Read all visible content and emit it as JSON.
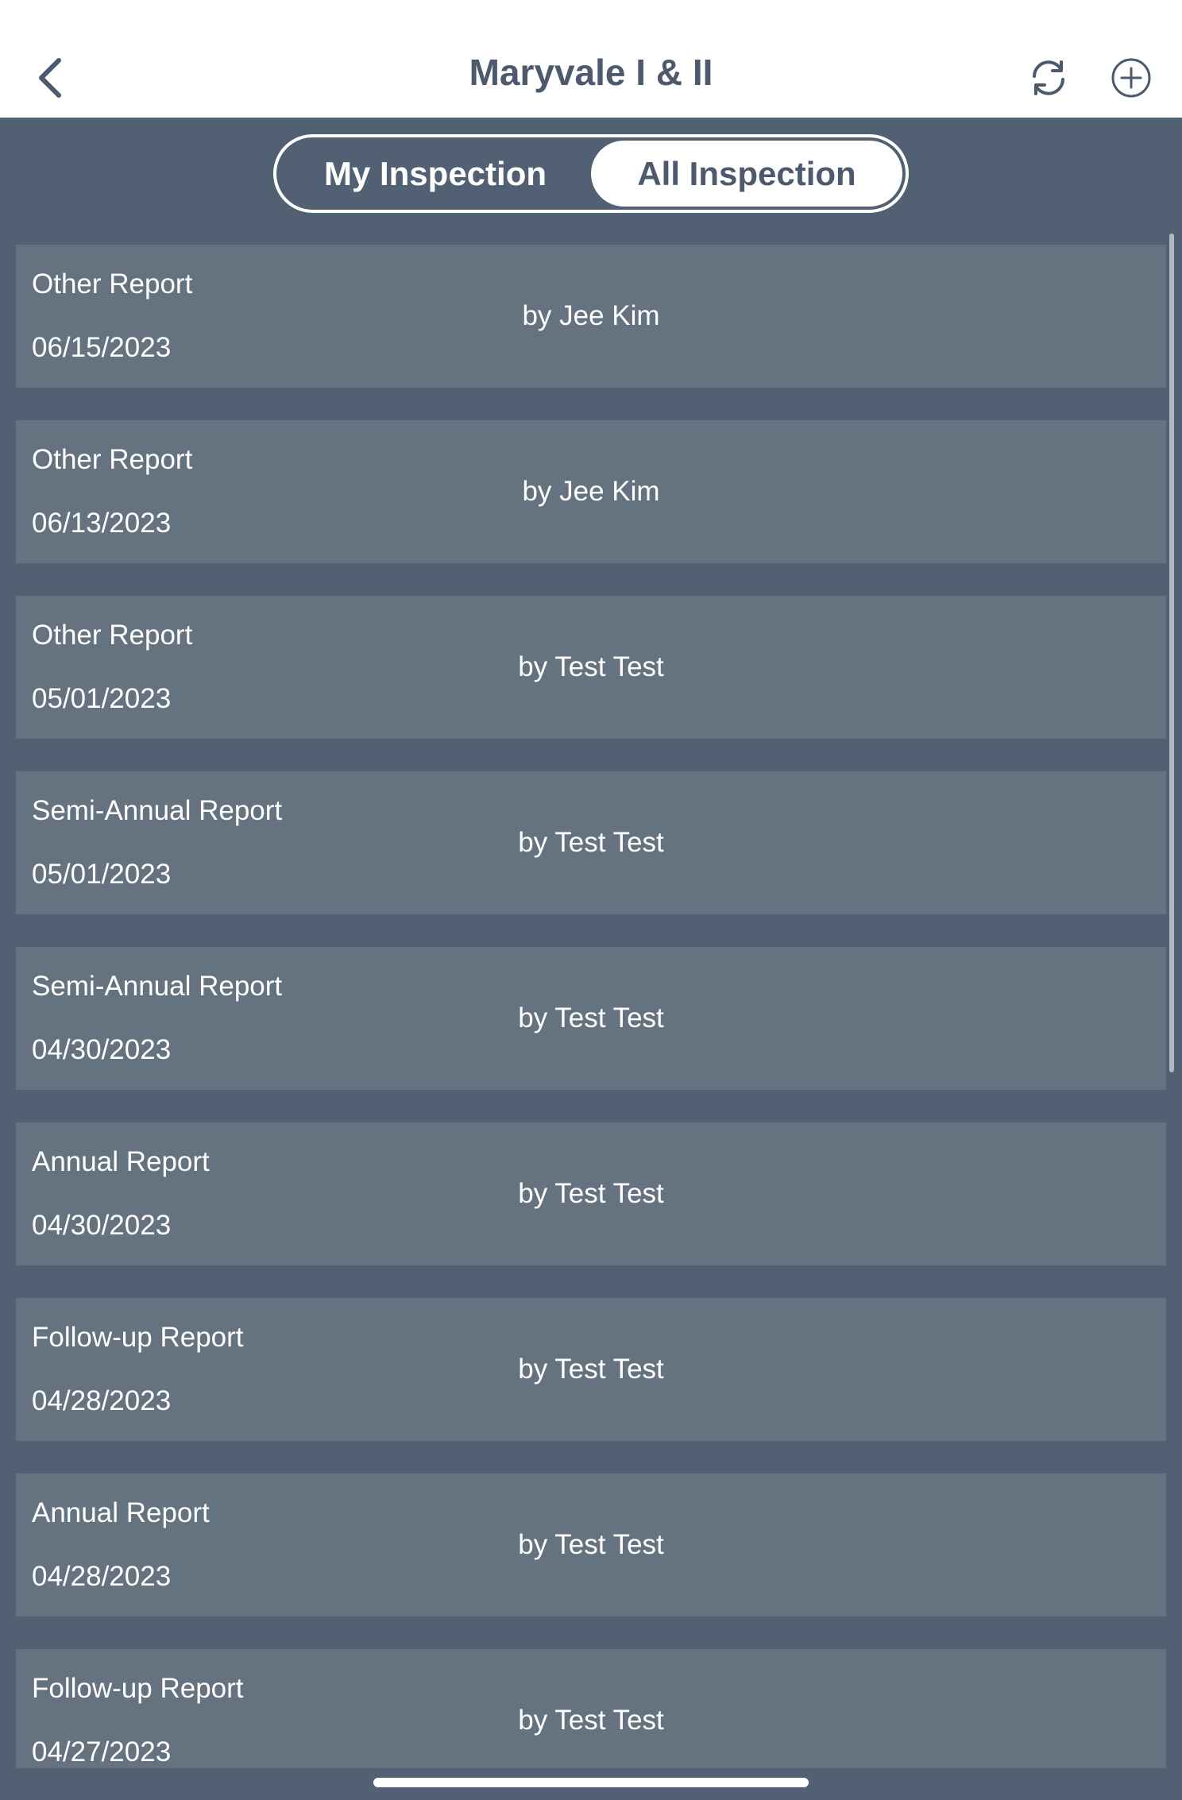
{
  "header": {
    "title": "Maryvale I & II",
    "back_icon": "chevron-left-icon",
    "sync_icon": "refresh-icon",
    "add_icon": "plus-circle-icon"
  },
  "segment": {
    "tabs": [
      {
        "label": "My Inspection",
        "selected": false
      },
      {
        "label": "All Inspection",
        "selected": true
      }
    ]
  },
  "reports": [
    {
      "type": "Other Report",
      "date": "06/15/2023",
      "author": "by Jee Kim"
    },
    {
      "type": "Other Report",
      "date": "06/13/2023",
      "author": "by Jee Kim"
    },
    {
      "type": "Other Report",
      "date": "05/01/2023",
      "author": "by Test Test"
    },
    {
      "type": "Semi-Annual Report",
      "date": "05/01/2023",
      "author": "by Test Test"
    },
    {
      "type": "Semi-Annual Report",
      "date": "04/30/2023",
      "author": "by Test Test"
    },
    {
      "type": "Annual Report",
      "date": "04/30/2023",
      "author": "by Test Test"
    },
    {
      "type": "Follow-up Report",
      "date": "04/28/2023",
      "author": "by Test Test"
    },
    {
      "type": "Annual Report",
      "date": "04/28/2023",
      "author": "by Test Test"
    },
    {
      "type": "Follow-up Report",
      "date": "04/27/2023",
      "author": "by Test Test"
    }
  ],
  "colors": {
    "background": "#526074",
    "row": "#65727f",
    "header_text": "#4d5a6e",
    "white": "#ffffff"
  }
}
